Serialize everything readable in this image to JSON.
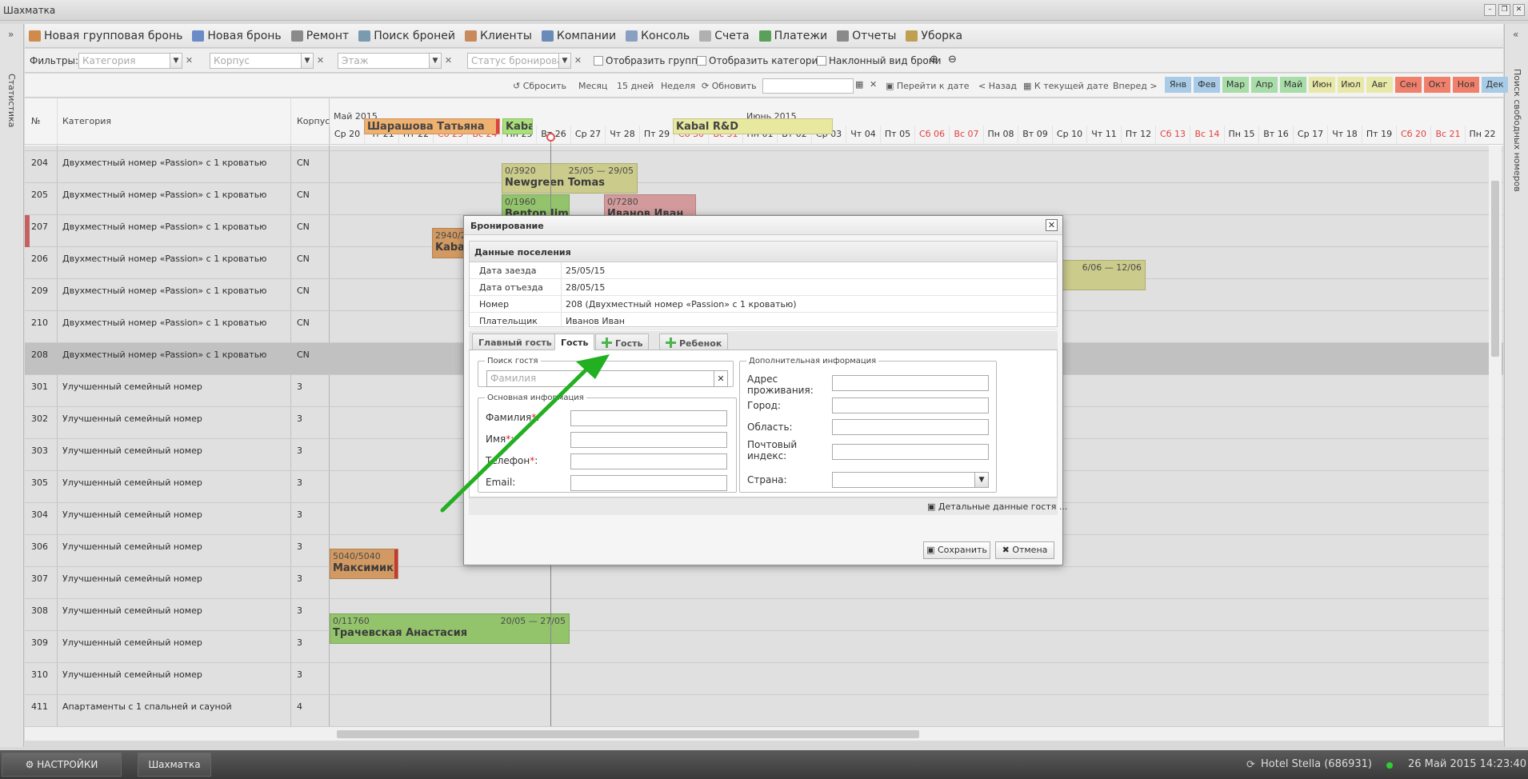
{
  "window": {
    "title": "Шахматка"
  },
  "sidebar_left": {
    "label": "Статистика"
  },
  "sidebar_right": {
    "label": "Поиск свободных номеров"
  },
  "toolbar": [
    {
      "label": "Новая групповая бронь",
      "icon": "group-booking-icon",
      "color": "#d08a4a"
    },
    {
      "label": "Новая бронь",
      "icon": "key-icon",
      "color": "#6a8ac8"
    },
    {
      "label": "Ремонт",
      "icon": "wrench-icon",
      "color": "#8a8a8a"
    },
    {
      "label": "Поиск броней",
      "icon": "search-icon",
      "color": "#7a9ab0"
    },
    {
      "label": "Клиенты",
      "icon": "users-icon",
      "color": "#c88a5a"
    },
    {
      "label": "Компании",
      "icon": "building-icon",
      "color": "#6a8ab8"
    },
    {
      "label": "Консоль",
      "icon": "console-icon",
      "color": "#8aa0c0"
    },
    {
      "label": "Счета",
      "icon": "invoice-icon",
      "color": "#b0b0b0"
    },
    {
      "label": "Платежи",
      "icon": "dollar-icon",
      "color": "#5aa05a"
    },
    {
      "label": "Отчеты",
      "icon": "printer-icon",
      "color": "#8a8a8a"
    },
    {
      "label": "Уборка",
      "icon": "broom-icon",
      "color": "#c0a050"
    }
  ],
  "filters": {
    "label": "Фильтры:",
    "category_placeholder": "Категория",
    "building_placeholder": "Корпус",
    "floor_placeholder": "Этаж",
    "status_placeholder": "Статус бронирован",
    "show_groups": "Отобразить группы",
    "show_categories": "Отобразить категории",
    "tilted_view": "Наклонный вид брони"
  },
  "nav": {
    "reset": "Сбросить",
    "month": "Месяц",
    "days15": "15 дней",
    "week": "Неделя",
    "refresh": "Обновить",
    "goto_date": "Перейти к дате",
    "back": "< Назад",
    "today": "К текущей дате",
    "forward": "Вперед >",
    "months": [
      "Янв",
      "Фев",
      "Мар",
      "Апр",
      "Май",
      "Июн",
      "Июл",
      "Авг",
      "Сен",
      "Окт",
      "Ноя",
      "Дек"
    ],
    "month_colors": [
      "#a8cce8",
      "#a8cce8",
      "#a8dca8",
      "#a8dca8",
      "#a8dca8",
      "#e8e8a8",
      "#e8e8a8",
      "#e8e8a8",
      "#f0806c",
      "#f0806c",
      "#f0806c",
      "#a8cce8"
    ]
  },
  "grid": {
    "col_no": "№",
    "col_category": "Категория",
    "col_building": "Корпус",
    "month1": "Май 2015",
    "month2": "Июнь 2015",
    "days": [
      {
        "l": "Ср 20",
        "we": false
      },
      {
        "l": "Чт 21",
        "we": false
      },
      {
        "l": "Пт 22",
        "we": false
      },
      {
        "l": "Сб 23",
        "we": true
      },
      {
        "l": "Вс 24",
        "we": true
      },
      {
        "l": "Пн 25",
        "we": false
      },
      {
        "l": "Вт 26",
        "we": false
      },
      {
        "l": "Ср 27",
        "we": false
      },
      {
        "l": "Чт 28",
        "we": false
      },
      {
        "l": "Пт 29",
        "we": false
      },
      {
        "l": "Сб 30",
        "we": true
      },
      {
        "l": "Вс 31",
        "we": true
      },
      {
        "l": "Пн 01",
        "we": false
      },
      {
        "l": "Вт 02",
        "we": false
      },
      {
        "l": "Ср 03",
        "we": false
      },
      {
        "l": "Чт 04",
        "we": false
      },
      {
        "l": "Пт 05",
        "we": false
      },
      {
        "l": "Сб 06",
        "we": true
      },
      {
        "l": "Вс 07",
        "we": true
      },
      {
        "l": "Пн 08",
        "we": false
      },
      {
        "l": "Вт 09",
        "we": false
      },
      {
        "l": "Ср 10",
        "we": false
      },
      {
        "l": "Чт 11",
        "we": false
      },
      {
        "l": "Пт 12",
        "we": false
      },
      {
        "l": "Сб 13",
        "we": true
      },
      {
        "l": "Вс 14",
        "we": true
      },
      {
        "l": "Пн 15",
        "we": false
      },
      {
        "l": "Вт 16",
        "we": false
      },
      {
        "l": "Ср 17",
        "we": false
      },
      {
        "l": "Чт 18",
        "we": false
      },
      {
        "l": "Пт 19",
        "we": false
      },
      {
        "l": "Сб 20",
        "we": true
      },
      {
        "l": "Вс 21",
        "we": true
      },
      {
        "l": "Пн 22",
        "we": false
      }
    ],
    "rows": [
      {
        "no": "204",
        "cat": "Двухместный номер «Passion» с 1 кроватью",
        "b": "CN"
      },
      {
        "no": "205",
        "cat": "Двухместный номер «Passion» с 1 кроватью",
        "b": "CN"
      },
      {
        "no": "207",
        "cat": "Двухместный номер «Passion» с 1 кроватью",
        "b": "CN"
      },
      {
        "no": "206",
        "cat": "Двухместный номер «Passion» с 1 кроватью",
        "b": "CN"
      },
      {
        "no": "209",
        "cat": "Двухместный номер «Passion» с 1 кроватью",
        "b": "CN"
      },
      {
        "no": "210",
        "cat": "Двухместный номер «Passion» с 1 кроватью",
        "b": "CN"
      },
      {
        "no": "208",
        "cat": "Двухместный номер «Passion» с 1 кроватью",
        "b": "CN"
      },
      {
        "no": "301",
        "cat": "Улучшенный семейный номер",
        "b": "3"
      },
      {
        "no": "302",
        "cat": "Улучшенный семейный номер",
        "b": "3"
      },
      {
        "no": "303",
        "cat": "Улучшенный семейный номер",
        "b": "3"
      },
      {
        "no": "305",
        "cat": "Улучшенный семейный номер",
        "b": "3"
      },
      {
        "no": "304",
        "cat": "Улучшенный семейный номер",
        "b": "3"
      },
      {
        "no": "306",
        "cat": "Улучшенный семейный номер",
        "b": "3"
      },
      {
        "no": "307",
        "cat": "Улучшенный семейный номер",
        "b": "3"
      },
      {
        "no": "308",
        "cat": "Улучшенный семейный номер",
        "b": "3"
      },
      {
        "no": "309",
        "cat": "Улучшенный семейный номер",
        "b": "3"
      },
      {
        "no": "310",
        "cat": "Улучшенный семейный номер",
        "b": "3"
      },
      {
        "no": "411",
        "cat": "Апартаменты с 1 спальней и сауной",
        "b": "4"
      }
    ],
    "bookings": [
      {
        "name": "Шарашова Татьяна",
        "amount": "",
        "dates": "",
        "color": "#f0b070"
      },
      {
        "name": "Kabal",
        "amount": "",
        "dates": "",
        "color": "#a8e07a"
      },
      {
        "name": "Kabal R&D",
        "amount": "",
        "dates": "",
        "color": "#e8e8a0"
      },
      {
        "name": "Newgreen Tomas",
        "amount": "0/3920",
        "dates": "25/05 — 29/05",
        "color": "#e8e8a0"
      },
      {
        "name": "Benton Jim",
        "amount": "0/1960",
        "dates": "",
        "color": "#a8e07a"
      },
      {
        "name": "Иванов Иван",
        "amount": "0/7280",
        "dates": "",
        "color": "#f0b0b0"
      },
      {
        "name": "Kabal",
        "amount": "2940/2",
        "dates": "",
        "color": "#f0b070"
      },
      {
        "name": "",
        "amount": "",
        "dates": "6/06 — 12/06",
        "color": "#e8e8a0"
      },
      {
        "name": "Максимик Д",
        "amount": "5040/5040",
        "dates": "",
        "color": "#f0b070"
      },
      {
        "name": "Трачевская Анастасия",
        "amount": "0/11760",
        "dates": "20/05 — 27/05",
        "color": "#a8e07a"
      }
    ]
  },
  "dialog": {
    "title": "Бронирование",
    "panel_title": "Данные поселения",
    "info": [
      {
        "k": "Дата заезда",
        "v": "25/05/15"
      },
      {
        "k": "Дата отъезда",
        "v": "28/05/15"
      },
      {
        "k": "Номер",
        "v": "208 (Двухместный номер «Passion» с 1 кроватью)"
      },
      {
        "k": "Плательщик",
        "v": "Иванов Иван"
      }
    ],
    "tabs": {
      "main_guest": "Главный гость",
      "guest": "Гость",
      "add_guest": "Гость",
      "add_child": "Ребенок"
    },
    "search_legend": "Поиск гостя",
    "search_placeholder": "Фамилия",
    "basic_legend": "Основная информация",
    "surname": "Фамилия",
    "name": "Имя",
    "phone": "Телефон",
    "email": "Email",
    "extra_legend": "Дополнительная информация",
    "address": "Адрес проживания:",
    "city": "Город:",
    "region": "Область:",
    "zip": "Почтовый индекс:",
    "country": "Страна:",
    "details_link": "Детальные данные гостя ...",
    "save": "Сохранить",
    "cancel": "Отмена"
  },
  "taskbar": {
    "settings": "НАСТРОЙКИ",
    "chess": "Шахматка",
    "hotel": "Hotel Stella (686931)",
    "datetime": "26 Май 2015 14:23:40"
  },
  "annotation_arrow_color": "#22b022"
}
